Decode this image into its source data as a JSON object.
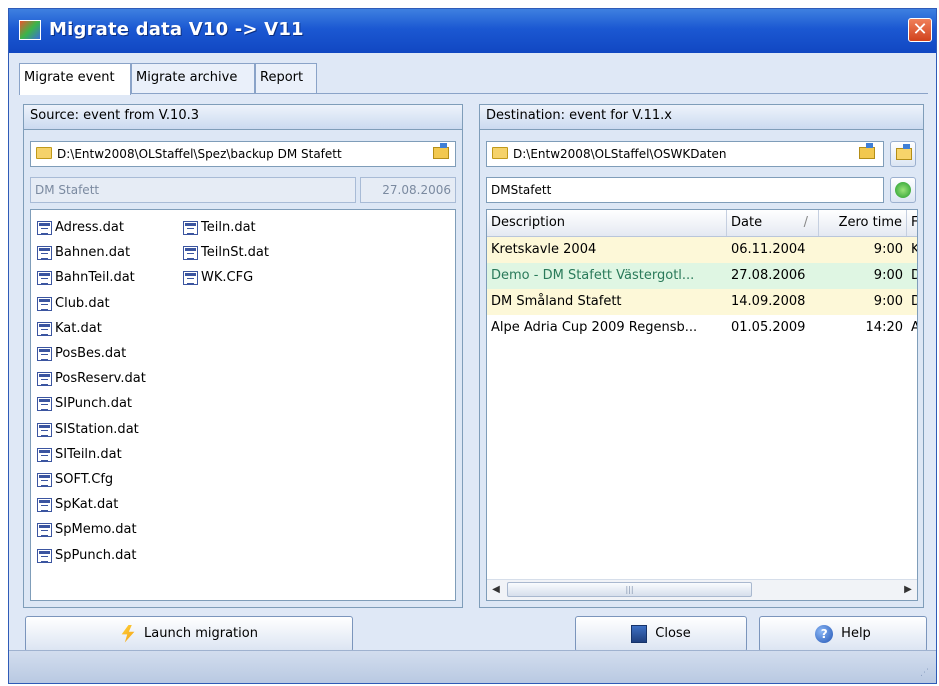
{
  "window": {
    "title": "Migrate data V10 -> V11",
    "close_glyph": "✕"
  },
  "tabs": [
    {
      "label": "Migrate event"
    },
    {
      "label": "Migrate archive"
    },
    {
      "label": "Report"
    }
  ],
  "source": {
    "header": "Source: event from V.10.3",
    "path": "D:\\Entw2008\\OLStaffel\\Spez\\backup DM Stafett",
    "event_name": "DM Stafett",
    "event_date": "27.08.2006",
    "files_col1": [
      "Adress.dat",
      "Bahnen.dat",
      "BahnTeil.dat",
      "Club.dat",
      "Kat.dat",
      "PosBes.dat",
      "PosReserv.dat",
      "SIPunch.dat",
      "SIStation.dat",
      "SITeiln.dat",
      "SOFT.Cfg",
      "SpKat.dat",
      "SpMemo.dat",
      "SpPunch.dat"
    ],
    "files_col2": [
      "Teiln.dat",
      "TeilnSt.dat",
      "WK.CFG"
    ]
  },
  "destination": {
    "header": "Destination: event for V.11.x",
    "path": "D:\\Entw2008\\OLStaffel\\OSWKDaten",
    "event_name": "DMStafett",
    "columns": [
      "Description",
      "Date",
      "/",
      "Zero time",
      "F"
    ],
    "rows": [
      {
        "description": "Kretskavle 2004",
        "date": "06.11.2004",
        "zero_time": "9:00",
        "extra": "K",
        "color": "#fdf8d8"
      },
      {
        "description": "Demo - DM Stafett Västergotl...",
        "date": "27.08.2006",
        "zero_time": "9:00",
        "extra": "D",
        "color": "#dff6e3"
      },
      {
        "description": "DM Småland Stafett",
        "date": "14.09.2008",
        "zero_time": "9:00",
        "extra": "D",
        "color": "#fdf8d8"
      },
      {
        "description": "Alpe Adria Cup 2009 Regensb...",
        "date": "01.05.2009",
        "zero_time": "14:20",
        "extra": "A",
        "color": "#ffffff"
      }
    ],
    "scroll_left": "◀",
    "scroll_right": "▶",
    "scroll_grip": "|||"
  },
  "buttons": {
    "launch": "Launch migration",
    "close": "Close",
    "help": "Help",
    "help_glyph": "?"
  },
  "colors": {
    "titlebar": "#1b58d2",
    "accent": "#2f5bb7"
  }
}
